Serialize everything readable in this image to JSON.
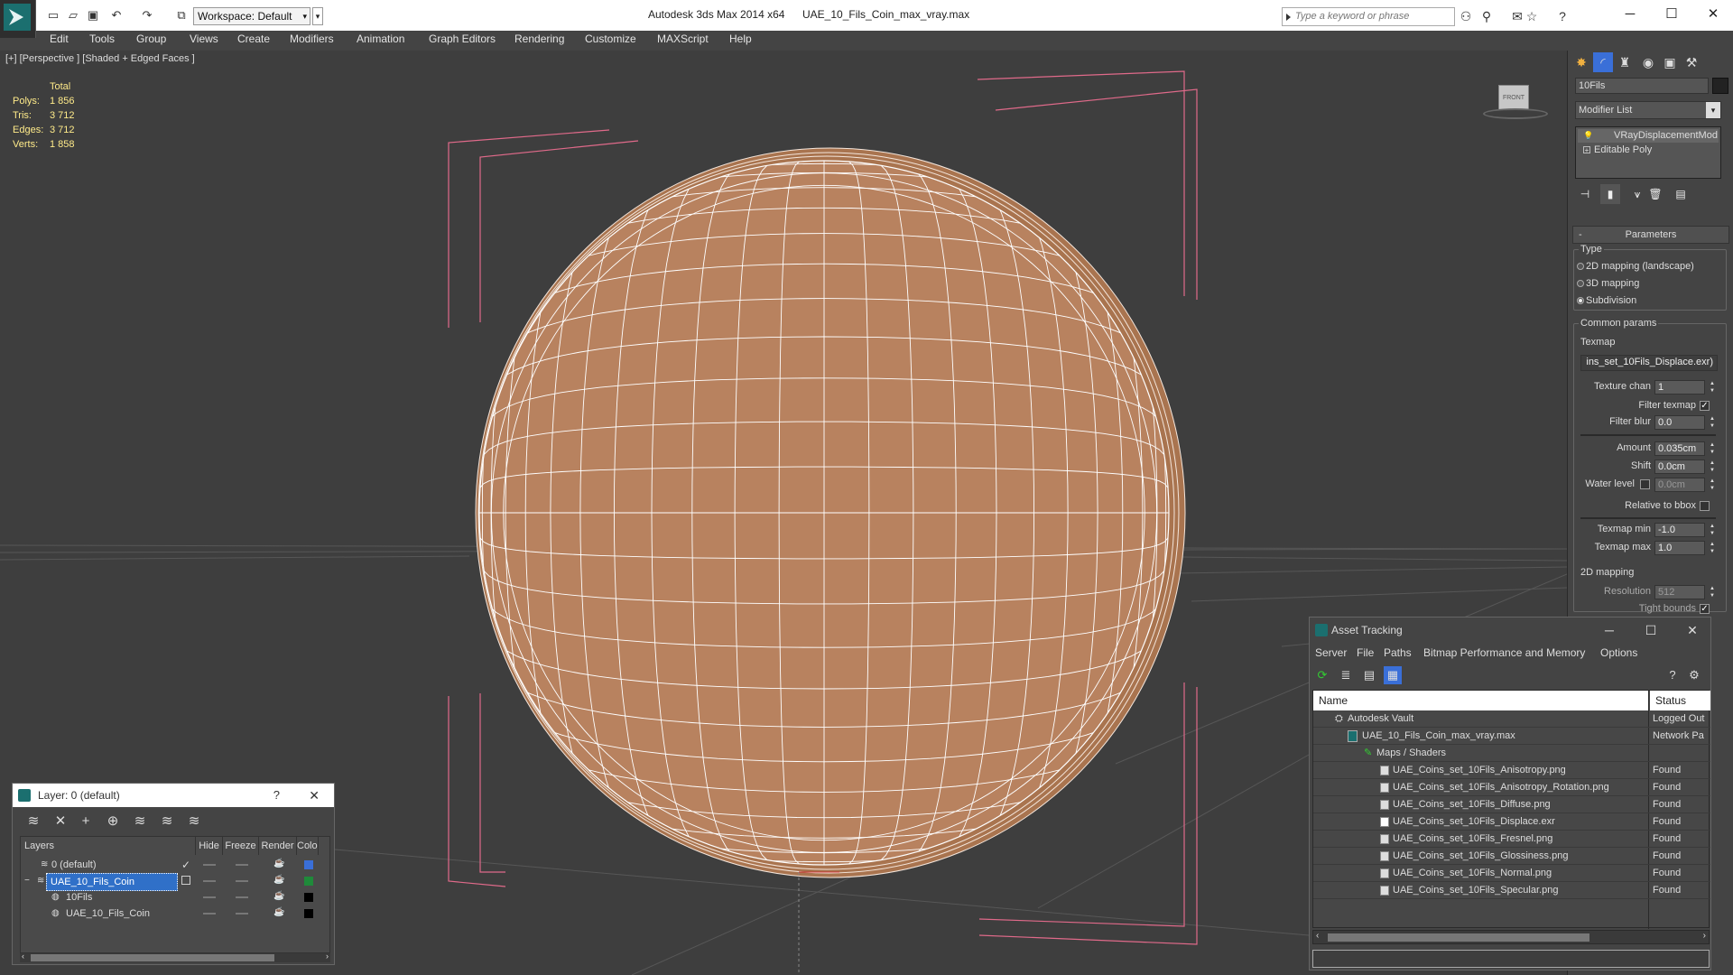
{
  "titlebar": {
    "workspace": "Workspace: Default",
    "app_title": "Autodesk 3ds Max  2014 x64",
    "file_title": "UAE_10_Fils_Coin_max_vray.max",
    "search_placeholder": "Type a keyword or phrase"
  },
  "menu": [
    "Edit",
    "Tools",
    "Group",
    "Views",
    "Create",
    "Modifiers",
    "Animation",
    "Graph Editors",
    "Rendering",
    "Customize",
    "MAXScript",
    "Help"
  ],
  "viewport": {
    "label": "[+] [Perspective ] [Shaded + Edged Faces ]",
    "stats_header": "Total",
    "stats": [
      {
        "label": "Polys:",
        "value": "1 856"
      },
      {
        "label": "Tris:",
        "value": "3 712"
      },
      {
        "label": "Edges:",
        "value": "3 712"
      },
      {
        "label": "Verts:",
        "value": "1 858"
      }
    ],
    "viewcube_text": "FRONT",
    "coin_color": "#b8825f",
    "mesh_color": "#ffffff"
  },
  "command_panel": {
    "object_name": "10Fils",
    "modifier_list": "Modifier List",
    "stack": [
      "VRayDisplacementMod",
      "Editable Poly"
    ],
    "rollout_title": "Parameters",
    "type_group": "Type",
    "type_options": [
      "2D mapping (landscape)",
      "3D mapping",
      "Subdivision"
    ],
    "type_selected": "Subdivision",
    "common_group": "Common params",
    "texmap_label": "Texmap",
    "texmap_value": "ins_set_10Fils_Displace.exr)",
    "texture_chan": {
      "label": "Texture chan",
      "value": "1"
    },
    "filter_texmap": {
      "label": "Filter texmap",
      "checked": true
    },
    "filter_blur": {
      "label": "Filter blur",
      "value": "0.0"
    },
    "amount": {
      "label": "Amount",
      "value": "0.035cm"
    },
    "shift": {
      "label": "Shift",
      "value": "0.0cm"
    },
    "water_level": {
      "label": "Water level",
      "value": "0.0cm"
    },
    "relative_bbox": {
      "label": "Relative to bbox"
    },
    "texmap_min": {
      "label": "Texmap min",
      "value": "-1.0"
    },
    "texmap_max": {
      "label": "Texmap max",
      "value": "1.0"
    },
    "mapping_group": "2D mapping",
    "resolution": {
      "label": "Resolution",
      "value": "512"
    },
    "tight_bounds": {
      "label": "Tight bounds"
    }
  },
  "layer_window": {
    "title": "Layer: 0 (default)",
    "help": "?",
    "columns": [
      "Layers",
      "Hide",
      "Freeze",
      "Render",
      "Color"
    ],
    "rows": [
      {
        "name": "0 (default)",
        "color": "#3a6fd8"
      },
      {
        "name": "UAE_10_Fils_Coin",
        "color": "#1f8a3a"
      },
      {
        "name": "10Fils",
        "color": "#000000"
      },
      {
        "name": "UAE_10_Fils_Coin",
        "color": "#000000"
      }
    ]
  },
  "asset_window": {
    "title": "Asset Tracking",
    "menu": [
      "Server",
      "File",
      "Paths",
      "Bitmap Performance and Memory",
      "Options"
    ],
    "columns": [
      "Name",
      "Status"
    ],
    "rows": [
      {
        "name": "Autodesk Vault",
        "status": "Logged Out"
      },
      {
        "name": "UAE_10_Fils_Coin_max_vray.max",
        "status": "Network Pa"
      },
      {
        "name": "Maps / Shaders",
        "status": ""
      },
      {
        "name": "UAE_Coins_set_10Fils_Anisotropy.png",
        "status": "Found"
      },
      {
        "name": "UAE_Coins_set_10Fils_Anisotropy_Rotation.png",
        "status": "Found"
      },
      {
        "name": "UAE_Coins_set_10Fils_Diffuse.png",
        "status": "Found"
      },
      {
        "name": "UAE_Coins_set_10Fils_Displace.exr",
        "status": "Found"
      },
      {
        "name": "UAE_Coins_set_10Fils_Fresnel.png",
        "status": "Found"
      },
      {
        "name": "UAE_Coins_set_10Fils_Glossiness.png",
        "status": "Found"
      },
      {
        "name": "UAE_Coins_set_10Fils_Normal.png",
        "status": "Found"
      },
      {
        "name": "UAE_Coins_set_10Fils_Specular.png",
        "status": "Found"
      }
    ]
  }
}
